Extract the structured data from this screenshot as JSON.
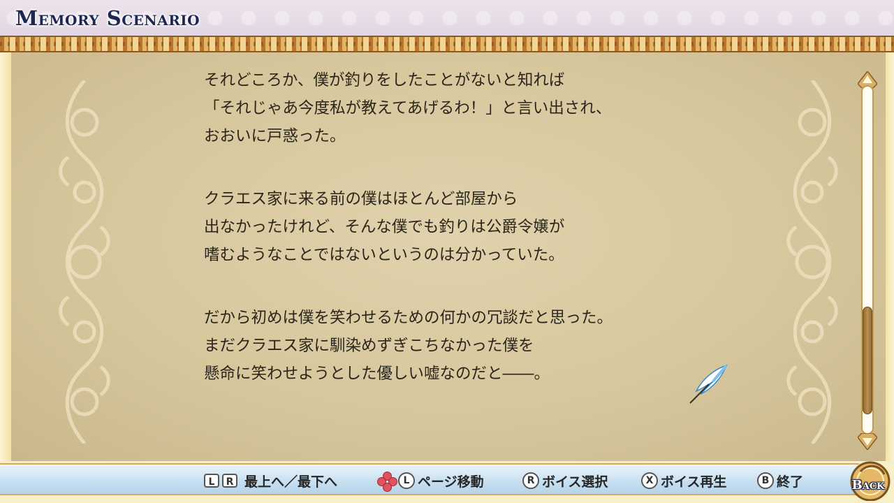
{
  "header": {
    "title": "Memory Scenario"
  },
  "story": {
    "paragraphs": [
      [
        "それどころか、僕が釣りをしたことがないと知れば",
        "「それじゃあ今度私が教えてあげるわ！」と言い出され、",
        "おおいに戸惑った。"
      ],
      [
        "クラエス家に来る前の僕はほとんど部屋から",
        "出なかったけれど、そんな僕でも釣りは公爵令嬢が",
        "嗜むようなことではないというのは分かっていた。"
      ],
      [
        "だから初めは僕を笑わせるための何かの冗談だと思った。",
        "まだクラエス家に馴染めずぎこちなかった僕を",
        "懸命に笑わせようとした優しい嘘なのだと――。"
      ]
    ]
  },
  "scrollbar": {
    "position_fraction": 0.92,
    "visible_fraction": 0.31
  },
  "controls": {
    "top_bottom": {
      "keys": [
        "L",
        "R"
      ],
      "label": "最上へ／最下へ"
    },
    "page_move": {
      "key": "L",
      "label": "ページ移動"
    },
    "voice_select": {
      "key": "R",
      "label": "ボイス選択"
    },
    "voice_play": {
      "key": "X",
      "label": "ボイス再生"
    },
    "end": {
      "key": "B",
      "label": "終了"
    },
    "back": {
      "label": "Back"
    }
  },
  "colors": {
    "title": "#1c2754",
    "text": "#2b261c",
    "gold_border": "#d7a85c",
    "bar_blue": "#c6dff0"
  }
}
